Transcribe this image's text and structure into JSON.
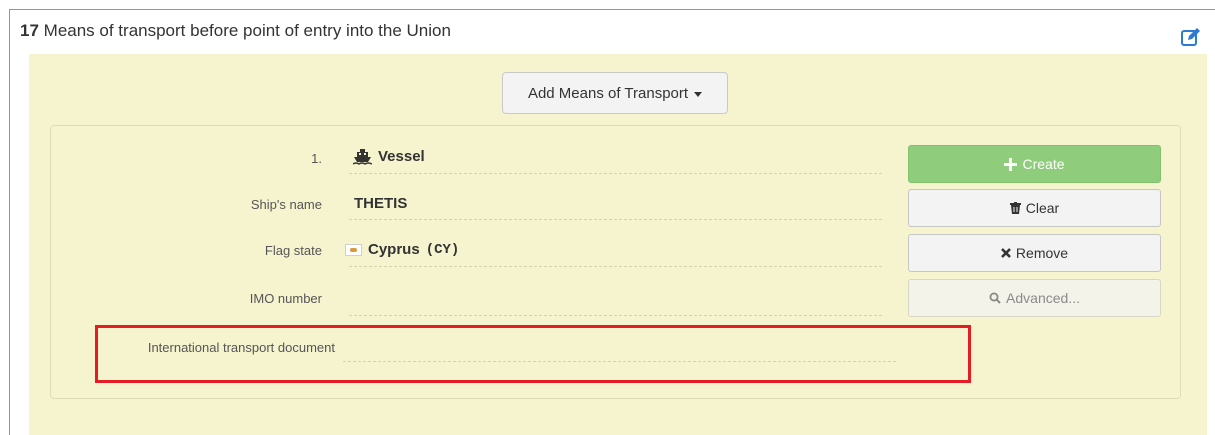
{
  "panel": {
    "number": "17",
    "title": "Means of transport before point of entry into the Union",
    "edit_icon": "edit-pencil-square-icon"
  },
  "add_button": {
    "label": "Add Means of Transport"
  },
  "transport": {
    "index": "1.",
    "type_icon": "ship-icon",
    "type": "Vessel",
    "ship_name_label": "Ship's name",
    "ship_name": "THETIS",
    "flag_state_label": "Flag state",
    "flag_state": "Cyprus",
    "flag_code": "(CY)",
    "imo_label": "IMO number",
    "imo_value": "",
    "itd_label": "International transport document",
    "itd_value": ""
  },
  "actions": {
    "create": "Create",
    "clear": "Clear",
    "remove": "Remove",
    "advanced": "Advanced..."
  },
  "colors": {
    "panel_border": "#6f9fd0",
    "area_background": "#f6f4cf",
    "create_button": "#8fcc7b",
    "highlight": "#e51c23",
    "edit_icon": "#2b7bd6"
  }
}
